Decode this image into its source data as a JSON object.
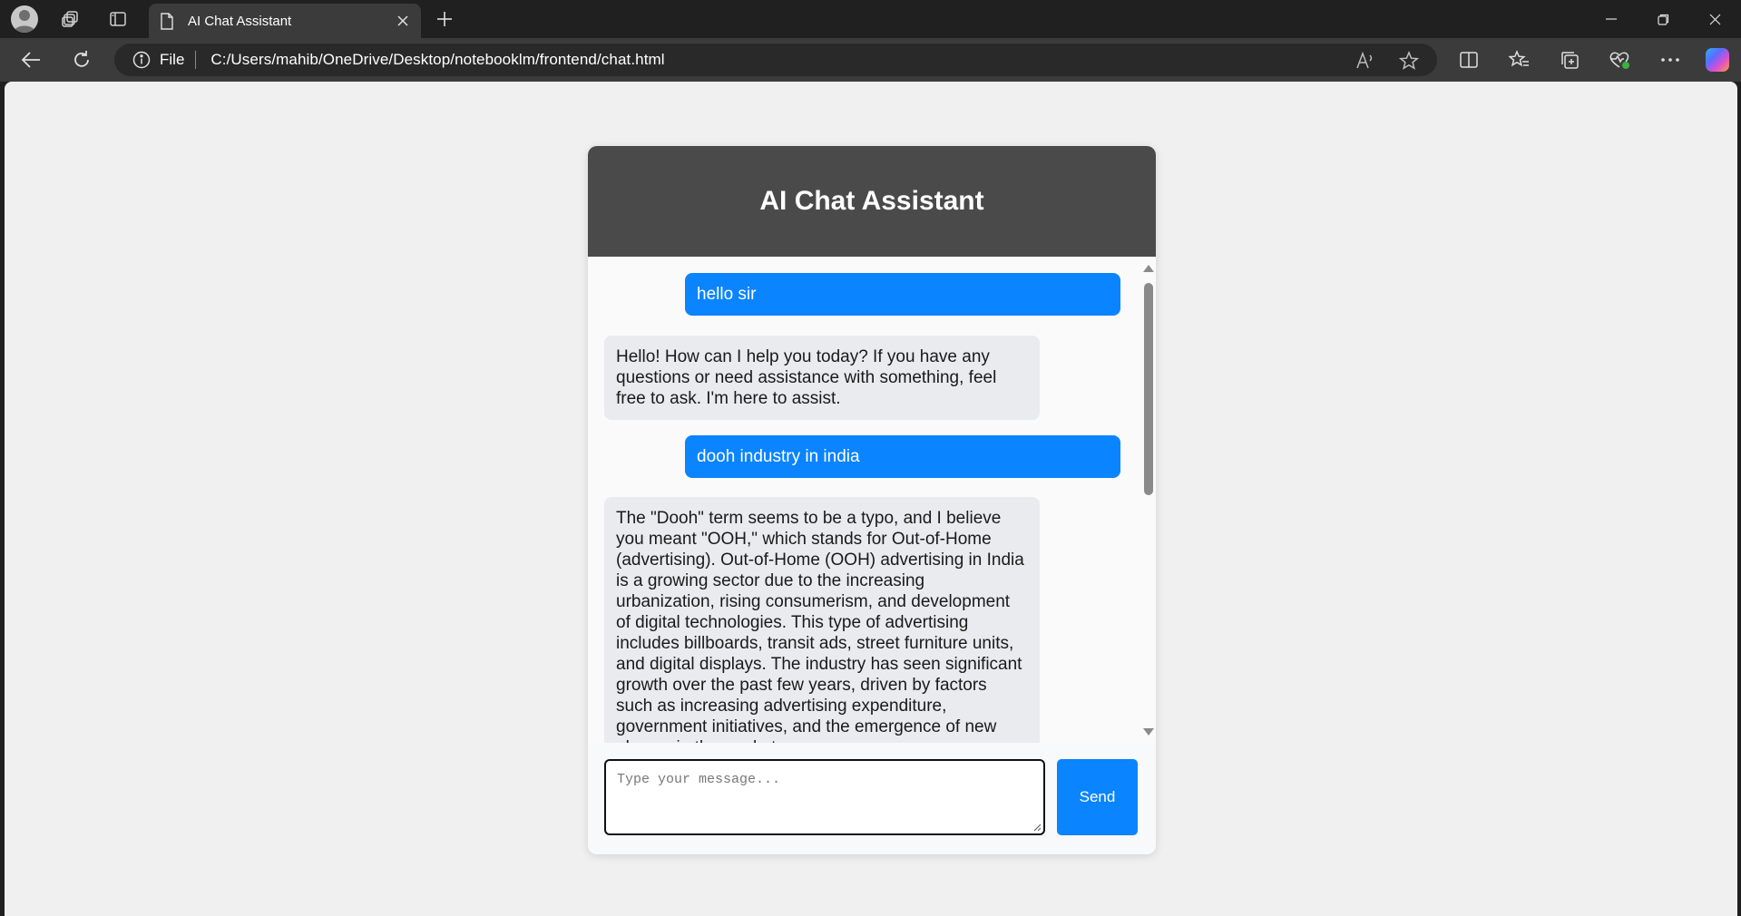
{
  "browser": {
    "tab_title": "AI Chat Assistant",
    "address": {
      "scheme_label": "File",
      "url": "C:/Users/mahib/OneDrive/Desktop/notebooklm/frontend/chat.html"
    },
    "icons": {
      "profile": "avatar-icon",
      "workspaces": "workspaces-icon",
      "vertical_tabs": "vertical-tabs-icon",
      "tab_page": "page-icon",
      "tab_close": "close-icon",
      "new_tab": "plus-icon",
      "back": "back-arrow-icon",
      "refresh": "refresh-icon",
      "site_info": "info-icon",
      "read_aloud": "read-aloud-icon",
      "favorite": "star-icon",
      "split_screen": "split-screen-icon",
      "favorites": "favorites-icon",
      "collections": "collections-icon",
      "browser_essentials": "heart-pulse-icon",
      "more": "more-icon",
      "copilot": "copilot-icon"
    }
  },
  "chat": {
    "title": "AI Chat Assistant",
    "messages": [
      {
        "role": "user",
        "text": "hello sir"
      },
      {
        "role": "bot",
        "text": "Hello! How can I help you today? If you have any questions or need assistance with something, feel free to ask. I'm here to assist."
      },
      {
        "role": "user",
        "text": "dooh industry in india"
      },
      {
        "role": "bot",
        "text": "The \"Dooh\" term seems to be a typo, and I believe you meant \"OOH,\" which stands for Out-of-Home (advertising). Out-of-Home (OOH) advertising in India is a growing sector due to the increasing urbanization, rising consumerism, and development of digital technologies. This type of advertising includes billboards, transit ads, street furniture units, and digital displays. The industry has seen significant growth over the past few years, driven by factors such as increasing advertising expenditure, government initiatives, and the emergence of new players in the market."
      }
    ],
    "input": {
      "placeholder": "Type your message...",
      "value": ""
    },
    "send_label": "Send"
  },
  "colors": {
    "header_bg": "#4a4a4a",
    "user_bubble": "#0a84ff",
    "bot_bubble": "#e9ebee",
    "send_button": "#0a84ff"
  }
}
